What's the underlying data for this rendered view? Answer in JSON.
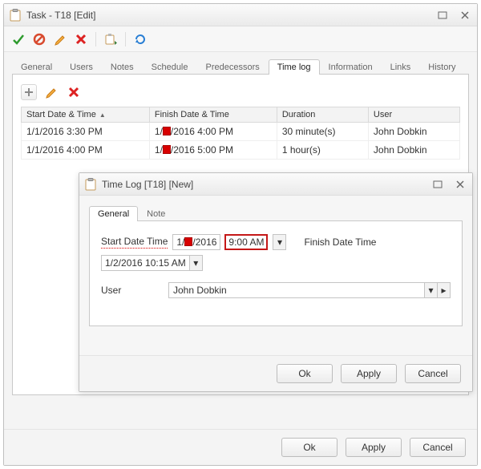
{
  "mainWindow": {
    "title": "Task - T18 [Edit]",
    "tabs": [
      "General",
      "Users",
      "Notes",
      "Schedule",
      "Predecessors",
      "Time log",
      "Information",
      "Links",
      "History"
    ],
    "activeTab": "Time log",
    "table": {
      "headers": [
        "Start Date & Time",
        "Finish Date & Time",
        "Duration",
        "User"
      ],
      "rows": [
        {
          "start_pre": "1/1/2016 3:30 PM",
          "finish_pre": "1/",
          "finish_post": "/2016 4:00 PM",
          "duration": "30 minute(s)",
          "user": "John Dobkin"
        },
        {
          "start_pre": "1/1/2016 4:00 PM",
          "finish_pre": "1/",
          "finish_post": "/2016 5:00 PM",
          "duration": "1 hour(s)",
          "user": "John Dobkin"
        }
      ]
    },
    "buttons": {
      "ok": "Ok",
      "apply": "Apply",
      "cancel": "Cancel"
    }
  },
  "dialog": {
    "title": "Time Log [T18] [New]",
    "tabs": [
      "General",
      "Note"
    ],
    "activeTab": "General",
    "startLabel": "Start Date  Time",
    "finishLabel": "Finish Date  Time",
    "userLabel": "User",
    "startDatePre": "1/",
    "startDatePost": "/2016",
    "startTime": "9:00 AM",
    "finishValue": "1/2/2016 10:15 AM",
    "userValue": "John Dobkin",
    "buttons": {
      "ok": "Ok",
      "apply": "Apply",
      "cancel": "Cancel"
    }
  }
}
